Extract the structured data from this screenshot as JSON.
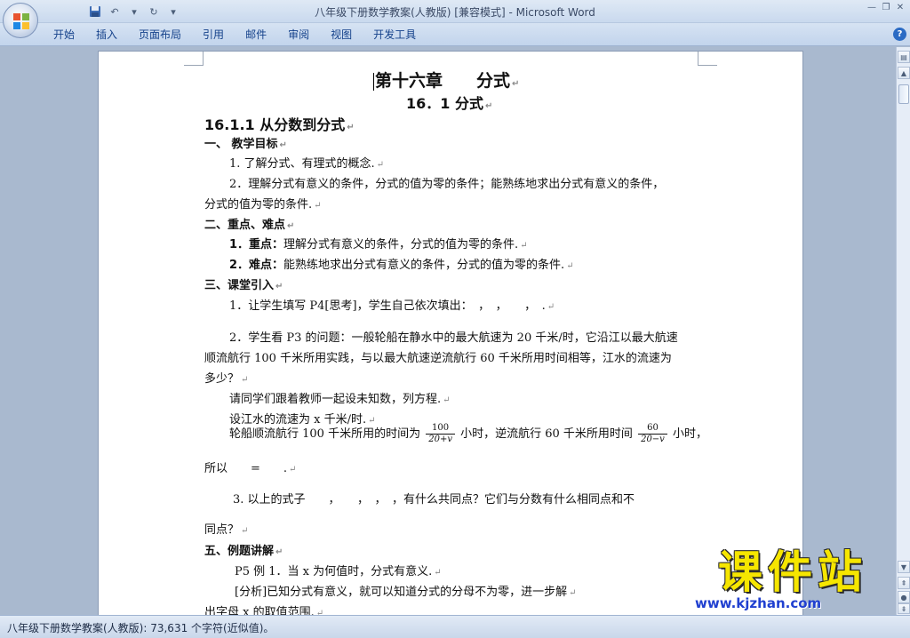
{
  "window": {
    "title": "八年级下册数学教案(人教版) [兼容模式]",
    "app_name": "Microsoft Word",
    "title_separator": " - "
  },
  "quick_access": {
    "save_icon": "save-icon",
    "undo_icon": "undo-icon",
    "redo_icon": "redo-icon",
    "customize_icon": "customize-icon"
  },
  "ribbon": {
    "tabs": [
      "开始",
      "插入",
      "页面布局",
      "引用",
      "邮件",
      "审阅",
      "视图",
      "开发工具"
    ]
  },
  "document": {
    "chapter_title": "第十六章　　分式",
    "section_title": "16．1 分式",
    "subsection_title": "16.1.1 从分数到分式",
    "s1_heading": "一、 教学目标",
    "s1_item1": "1.  了解分式、有理式的概念.",
    "s1_item2a": "2．理解分式有意义的条件，分式的值为零的条件；能熟练地求出分式有意义的条件，",
    "s1_item2b": "分式的值为零的条件.",
    "s2_heading": "二、重点、难点",
    "s2_item1_label": "1．重点：",
    "s2_item1_text": "理解分式有意义的条件，分式的值为零的条件.",
    "s2_item2_label": "2．难点：",
    "s2_item2_text": "能熟练地求出分式有意义的条件，分式的值为零的条件.",
    "s3_heading": "三、课堂引入",
    "s3_item1": "1．让学生填写 P4[思考]，学生自己依次填出：　，　，　　，　.",
    "s3_item2a": "2．学生看 P3 的问题：一般轮船在静水中的最大航速为 20 千米/时，它沿江以最大航速",
    "s3_item2b": "顺流航行 100 千米所用实践，与以最大航速逆流航行 60 千米所用时间相等，江水的流速为",
    "s3_item2c": "多少？",
    "s3_p1": "请同学们跟着教师一起设未知数，列方程.",
    "s3_p2": "设江水的流速为 x 千米/时.",
    "s3_p3a": "轮船顺流航行 100 千米所用的时间为",
    "frac1_num": "100",
    "frac1_den": "20+v",
    "s3_p3b": "小时，逆流航行 60 千米所用时间",
    "frac2_num": "60",
    "frac2_den": "20−v",
    "s3_p3c": "小时，",
    "s3_p4": "所以　　=　　.",
    "s3_item3a": "3. 以上的式子　　，　　，　，　，有什么共同点？它们与分数有什么相同点和不",
    "s3_item3b": "同点？",
    "s5_heading": "五、例题讲解",
    "s5_p1": "P5 例 1．当 x 为何值时，分式有意义.",
    "s5_p2": "[分析]已知分式有意义，就可以知道分式的分母不为零，进一步解",
    "s5_p3": "出字母 x 的取值范围."
  },
  "status": {
    "text": "八年级下册数学教案(人教版): 73,631 个字符(近似值)。"
  },
  "watermark": {
    "brand": "课件站",
    "url": "www.kjzhan.com"
  }
}
